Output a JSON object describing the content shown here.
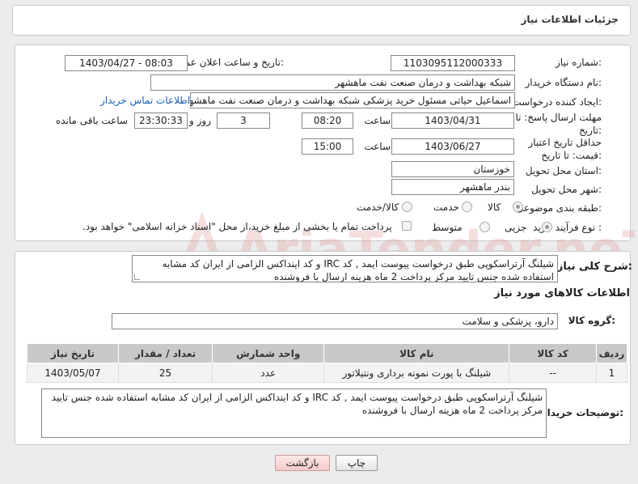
{
  "header": {
    "title": "جزئیات اطلاعات نیاز"
  },
  "form": {
    "need_number_label": "شماره نیاز:",
    "need_number": "1103095112000333",
    "announce_label": "تاریخ و ساعت اعلان عمومی:",
    "announce_value": "1403/04/27 - 08:03",
    "buyer_org_label": "نام دستگاه خریدار:",
    "buyer_org": "شبکه بهداشت و درمان صنعت نفت ماهشهر",
    "requester_label": "ایجاد کننده درخواست:",
    "requester": "اسماعیل حیاتی مسئول خرید پزشکی شبکه بهداشت و درمان صنعت نفت ماهشهر",
    "contact_link": "اطلاعات تماس خریدار",
    "deadline_label": "مهلت ارسال پاسخ: تا تاریخ:",
    "deadline_date": "1403/04/31",
    "time_label": "ساعت",
    "deadline_time": "08:20",
    "days_value": "3",
    "days_label": "روز و",
    "remaining_time": "23:30:33",
    "remaining_label": "ساعت باقی مانده",
    "validity_label": "حداقل تاریخ اعتبار قیمت: تا تاریخ:",
    "validity_date": "1403/06/27",
    "validity_time_label": "ساعت",
    "validity_time": "15:00",
    "province_label": "استان محل تحویل:",
    "province": "خوزستان",
    "city_label": "شهر محل تحویل:",
    "city": "بندر ماهشهر",
    "category_label": "طبقه بندی موضوعی:",
    "category_options": [
      "کالا",
      "خدمت",
      "کالا/خدمت"
    ],
    "process_label": "نوع فرآیند خرید :",
    "process_options": [
      "جزیی",
      "متوسط"
    ],
    "payment_note": "پرداخت تمام یا بخشی از مبلغ خرید،از محل \"اسناد خزانه اسلامی\" خواهد بود."
  },
  "description": {
    "label": "شرح کلی نیاز:",
    "text": "شیلنگ آرتراسکوپی طبق درخواست پیوست ایمد , کد IRC و کد اینداکس الزامی از ایران کد مشابه استفاده شده جنس تایید مرکز پرداخت 2 ماه هزینه ارسال با فروشنده"
  },
  "goods": {
    "section_title": "اطلاعات کالاهای مورد نیاز",
    "group_label": "گروه کالا:",
    "group_value": "دارو، پزشکی و سلامت",
    "columns": [
      "ردیف",
      "کد کالا",
      "نام کالا",
      "واحد شمارش",
      "تعداد / مقدار",
      "تاریخ نیاز"
    ],
    "rows": [
      [
        "1",
        "--",
        "شیلنگ با پورت نمونه برداری ونتیلاتور",
        "عدد",
        "25",
        "1403/05/07"
      ]
    ]
  },
  "buyer_notes": {
    "label": "توضیحات خریدار:",
    "text": "شیلنگ آرتراسکوپی طبق درخواست پیوست ایمد , کد IRC و کد اینداکس الزامی از ایران کد مشابه استفاده شده جنس تایید مرکز پرداخت 2 ماه هزینه ارسال با فروشنده"
  },
  "buttons": {
    "print": "چاپ",
    "back": "بازگشت"
  },
  "watermark_text": "AriaTender.neT",
  "colors": {
    "link": "#1a5fb4",
    "watermark": "#e2a3a3",
    "table_header": "#c8c8c8"
  }
}
